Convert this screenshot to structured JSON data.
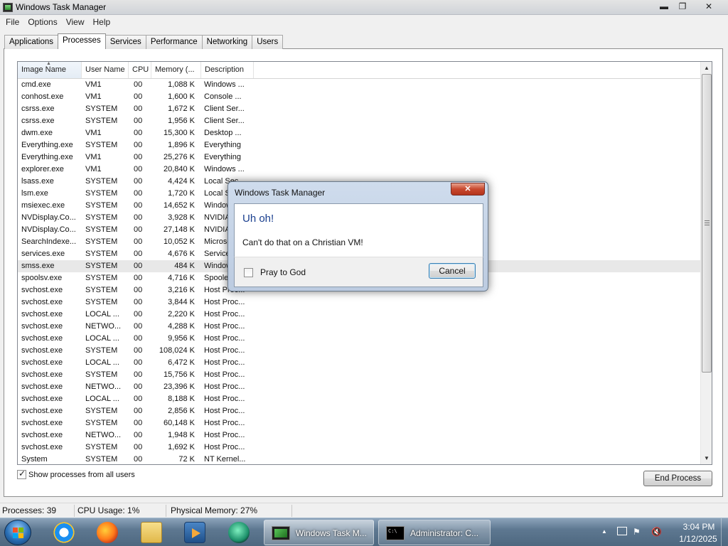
{
  "window": {
    "title": "Windows Task Manager",
    "controls": {
      "minimize": "▬",
      "maximize": "❐",
      "close": "✕"
    }
  },
  "menu": [
    "File",
    "Options",
    "View",
    "Help"
  ],
  "tabs": [
    "Applications",
    "Processes",
    "Services",
    "Performance",
    "Networking",
    "Users"
  ],
  "active_tab": "Processes",
  "process_table": {
    "columns": [
      "Image Name",
      "User Name",
      "CPU",
      "Memory (...",
      "Description"
    ],
    "sorted_column": "Image Name",
    "rows": [
      [
        "cmd.exe",
        "VM1",
        "00",
        "1,088 K",
        "Windows ..."
      ],
      [
        "conhost.exe",
        "VM1",
        "00",
        "1,600 K",
        "Console ..."
      ],
      [
        "csrss.exe",
        "SYSTEM",
        "00",
        "1,672 K",
        "Client Ser..."
      ],
      [
        "csrss.exe",
        "SYSTEM",
        "00",
        "1,956 K",
        "Client Ser..."
      ],
      [
        "dwm.exe",
        "VM1",
        "00",
        "15,300 K",
        "Desktop ..."
      ],
      [
        "Everything.exe",
        "SYSTEM",
        "00",
        "1,896 K",
        "Everything"
      ],
      [
        "Everything.exe",
        "VM1",
        "00",
        "25,276 K",
        "Everything"
      ],
      [
        "explorer.exe",
        "VM1",
        "00",
        "20,840 K",
        "Windows ..."
      ],
      [
        "lsass.exe",
        "SYSTEM",
        "00",
        "4,424 K",
        "Local Sec..."
      ],
      [
        "lsm.exe",
        "SYSTEM",
        "00",
        "1,720 K",
        "Local Ses..."
      ],
      [
        "msiexec.exe",
        "SYSTEM",
        "00",
        "14,652 K",
        "Windows ..."
      ],
      [
        "NVDisplay.Co...",
        "SYSTEM",
        "00",
        "3,928 K",
        "NVIDIA ..."
      ],
      [
        "NVDisplay.Co...",
        "SYSTEM",
        "00",
        "27,148 K",
        "NVIDIA ..."
      ],
      [
        "SearchIndexe...",
        "SYSTEM",
        "00",
        "10,052 K",
        "Microsoft ..."
      ],
      [
        "services.exe",
        "SYSTEM",
        "00",
        "4,676 K",
        "Services ..."
      ],
      [
        "smss.exe",
        "SYSTEM",
        "00",
        "484 K",
        "Windows ..."
      ],
      [
        "spoolsv.exe",
        "SYSTEM",
        "00",
        "4,716 K",
        "Spooler ..."
      ],
      [
        "svchost.exe",
        "SYSTEM",
        "00",
        "3,216 K",
        "Host Proc..."
      ],
      [
        "svchost.exe",
        "SYSTEM",
        "00",
        "3,844 K",
        "Host Proc..."
      ],
      [
        "svchost.exe",
        "LOCAL ...",
        "00",
        "2,220 K",
        "Host Proc..."
      ],
      [
        "svchost.exe",
        "NETWO...",
        "00",
        "4,288 K",
        "Host Proc..."
      ],
      [
        "svchost.exe",
        "LOCAL ...",
        "00",
        "9,956 K",
        "Host Proc..."
      ],
      [
        "svchost.exe",
        "SYSTEM",
        "00",
        "108,024 K",
        "Host Proc..."
      ],
      [
        "svchost.exe",
        "LOCAL ...",
        "00",
        "6,472 K",
        "Host Proc..."
      ],
      [
        "svchost.exe",
        "SYSTEM",
        "00",
        "15,756 K",
        "Host Proc..."
      ],
      [
        "svchost.exe",
        "NETWO...",
        "00",
        "23,396 K",
        "Host Proc..."
      ],
      [
        "svchost.exe",
        "LOCAL ...",
        "00",
        "8,188 K",
        "Host Proc..."
      ],
      [
        "svchost.exe",
        "SYSTEM",
        "00",
        "2,856 K",
        "Host Proc..."
      ],
      [
        "svchost.exe",
        "SYSTEM",
        "00",
        "60,148 K",
        "Host Proc..."
      ],
      [
        "svchost.exe",
        "NETWO...",
        "00",
        "1,948 K",
        "Host Proc..."
      ],
      [
        "svchost.exe",
        "SYSTEM",
        "00",
        "1,692 K",
        "Host Proc..."
      ],
      [
        "System",
        "SYSTEM",
        "00",
        "72 K",
        "NT Kernel..."
      ]
    ],
    "highlighted_row": "smss.exe"
  },
  "show_all_users": {
    "label": "Show processes from all users",
    "checked": true
  },
  "end_process_label": "End Process",
  "status": {
    "processes": "Processes: 39",
    "cpu": "CPU Usage: 1%",
    "memory": "Physical Memory: 27%"
  },
  "dialog": {
    "title": "Windows Task Manager",
    "close_glyph": "✕",
    "heading": "Uh oh!",
    "message": "Can't do that on a Christian VM!",
    "checkbox_label": "Pray to God",
    "checkbox_checked": false,
    "cancel_label": "Cancel"
  },
  "taskbar": {
    "pinned_icons": [
      "internet-explorer-icon",
      "firefox-icon",
      "windows-explorer-icon",
      "media-player-icon",
      "app-icon"
    ],
    "tasks": [
      {
        "label": "Windows Task M...",
        "icon": "task-manager-icon"
      },
      {
        "label": "Administrator:  C...",
        "icon": "command-prompt-icon"
      }
    ],
    "tray": {
      "show_hidden": "▲",
      "flag_glyph": "⚑",
      "volume_glyph": "🔇"
    },
    "clock": {
      "time": "3:04 PM",
      "date": "1/12/2025"
    }
  }
}
